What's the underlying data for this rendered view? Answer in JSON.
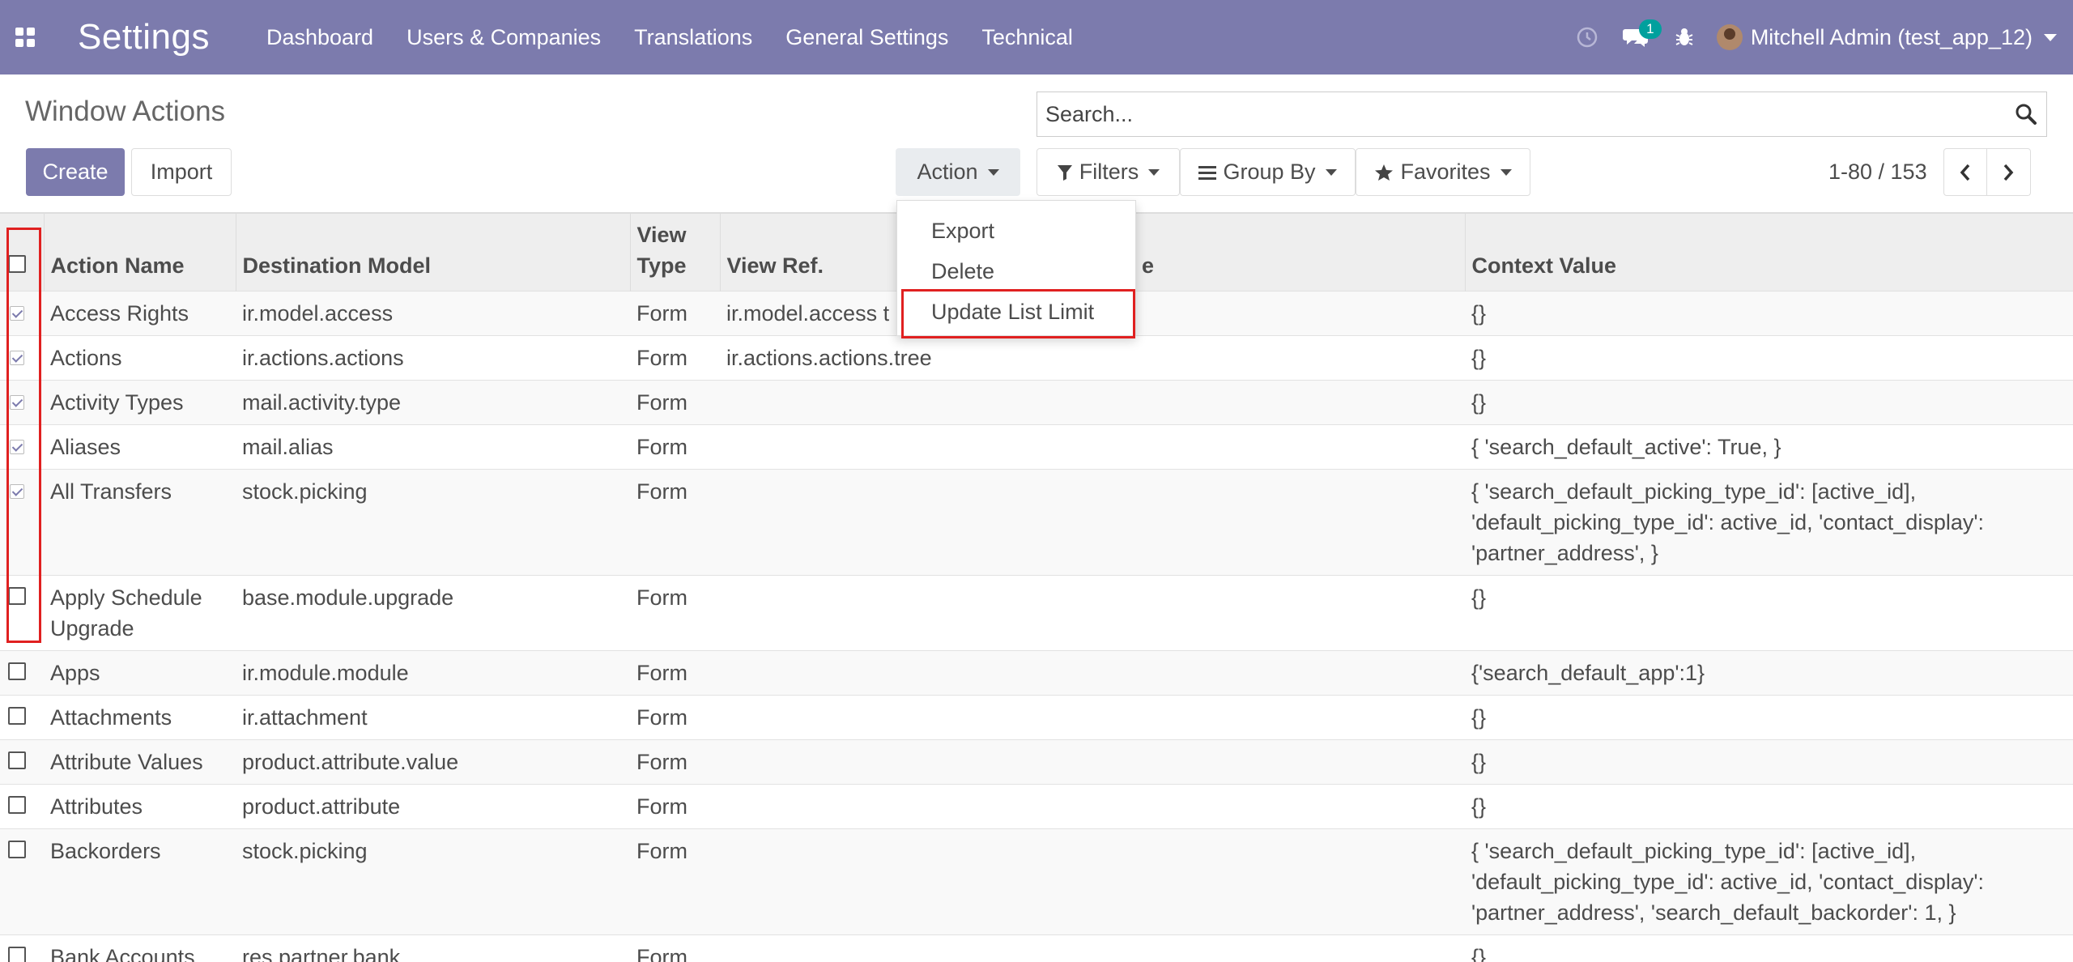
{
  "navbar": {
    "brand": "Settings",
    "menu": [
      "Dashboard",
      "Users & Companies",
      "Translations",
      "General Settings",
      "Technical"
    ],
    "messages_badge": "1",
    "user_name": "Mitchell Admin (test_app_12)",
    "color": "#7c7bad"
  },
  "control_panel": {
    "title": "Window Actions",
    "search_placeholder": "Search...",
    "create_label": "Create",
    "import_label": "Import",
    "action_label": "Action",
    "filters_label": "Filters",
    "group_by_label": "Group By",
    "favorites_label": "Favorites",
    "pager_value": "1-80 / 153"
  },
  "action_menu": {
    "items": [
      "Export",
      "Delete",
      "Update List Limit"
    ]
  },
  "table": {
    "headers": {
      "action_name": "Action Name",
      "destination_model": "Destination Model",
      "view_type_1": "View",
      "view_type_2": "Type",
      "view_ref": "View Ref.",
      "partial_hidden": "e",
      "context_value": "Context Value"
    },
    "rows": [
      {
        "name": "Access Rights",
        "model": "ir.model.access",
        "view_type": "Form",
        "view_ref": "ir.model.access t",
        "context": "{}",
        "checked": true
      },
      {
        "name": "Actions",
        "model": "ir.actions.actions",
        "view_type": "Form",
        "view_ref": "ir.actions.actions.tree",
        "context": "{}",
        "checked": true
      },
      {
        "name": "Activity Types",
        "model": "mail.activity.type",
        "view_type": "Form",
        "view_ref": "",
        "context": "{}",
        "checked": true
      },
      {
        "name": "Aliases",
        "model": "mail.alias",
        "view_type": "Form",
        "view_ref": "",
        "context": "{ 'search_default_active': True, }",
        "checked": true
      },
      {
        "name": "All Transfers",
        "model": "stock.picking",
        "view_type": "Form",
        "view_ref": "",
        "context_lines": [
          "{ 'search_default_picking_type_id': [active_id],",
          "'default_picking_type_id': active_id, 'contact_display':",
          "'partner_address', }"
        ],
        "checked": true
      },
      {
        "name_lines": [
          "Apply Schedule",
          "Upgrade"
        ],
        "model": "base.module.upgrade",
        "view_type": "Form",
        "view_ref": "",
        "context": "{}",
        "checked": false
      },
      {
        "name": "Apps",
        "model": "ir.module.module",
        "view_type": "Form",
        "view_ref": "",
        "context": "{'search_default_app':1}",
        "checked": false
      },
      {
        "name": "Attachments",
        "model": "ir.attachment",
        "view_type": "Form",
        "view_ref": "",
        "context": "{}",
        "checked": false
      },
      {
        "name": "Attribute Values",
        "model": "product.attribute.value",
        "view_type": "Form",
        "view_ref": "",
        "context": "{}",
        "checked": false
      },
      {
        "name": "Attributes",
        "model": "product.attribute",
        "view_type": "Form",
        "view_ref": "",
        "context": "{}",
        "checked": false
      },
      {
        "name": "Backorders",
        "model": "stock.picking",
        "view_type": "Form",
        "view_ref": "",
        "context_lines": [
          "{ 'search_default_picking_type_id': [active_id],",
          "'default_picking_type_id': active_id, 'contact_display':",
          "'partner_address', 'search_default_backorder': 1, }"
        ],
        "checked": false
      },
      {
        "name": "Bank Accounts",
        "model": "res.partner.bank",
        "view_type": "Form",
        "view_ref": "",
        "context": "{}",
        "checked": false
      }
    ]
  }
}
